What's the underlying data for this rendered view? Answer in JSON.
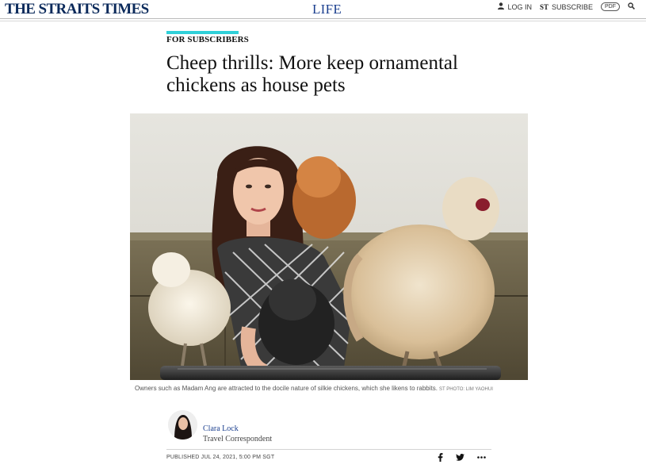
{
  "header": {
    "logo": "THE STRAITS TIMES",
    "section": "LIFE",
    "login_label": "LOG IN",
    "subscribe_badge": "ST",
    "subscribe_label": "SUBSCRIBE",
    "pdf_label": "PDF"
  },
  "article": {
    "kicker": "FOR SUBSCRIBERS",
    "headline": "Cheep thrills: More keep ornamental chickens as house pets",
    "caption": "Owners such as Madam Ang are attracted to the docile nature of silkie chickens, which she likens to rabbits.",
    "photo_credit": "ST PHOTO: LIM YAOHUI",
    "author": {
      "name": "Clara Lock",
      "title": "Travel Correspondent"
    },
    "published": "PUBLISHED  JUL 24, 2021, 5:00 PM SGT"
  },
  "share": {
    "facebook_icon": "facebook-icon",
    "twitter_icon": "twitter-icon",
    "more_icon": "more-icon"
  },
  "colors": {
    "brand": "#0b2a5b",
    "section": "#1b3f8f",
    "kicker_accent": "#2fd0d9"
  }
}
